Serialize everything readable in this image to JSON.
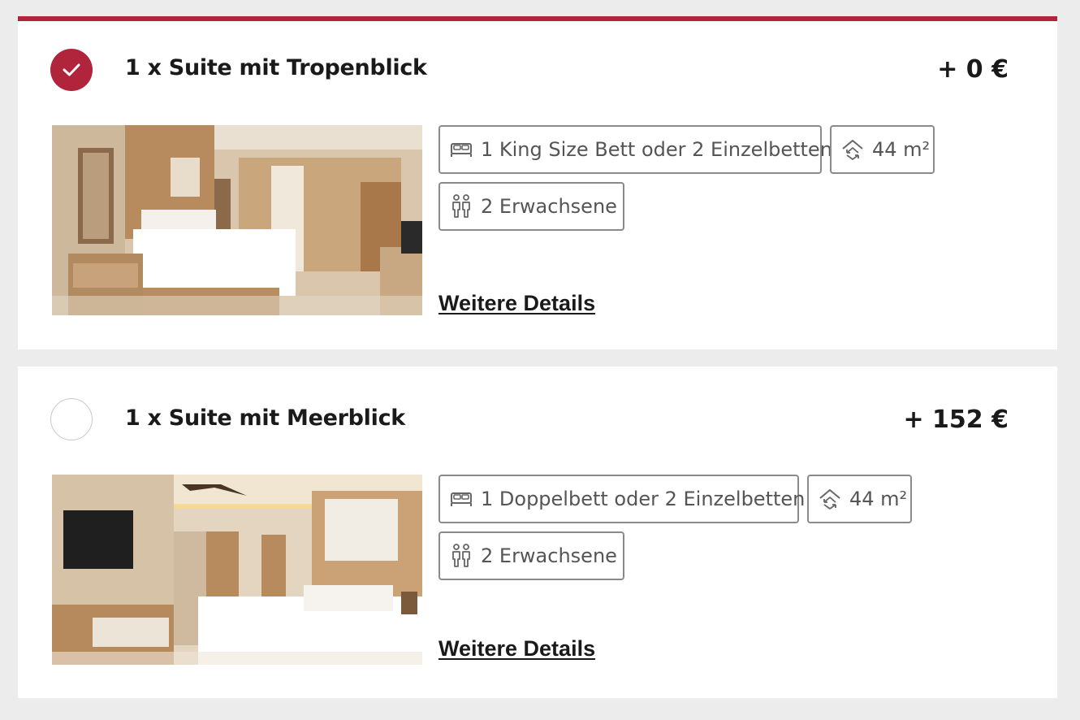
{
  "colors": {
    "accent": "#b0243c",
    "chip_border": "#8a8a8a",
    "background": "#ececec"
  },
  "rooms": [
    {
      "selected": true,
      "title": "1 x Suite mit Tropenblick",
      "price": "+ 0 €",
      "bed": "1 King Size Bett oder 2 Einzelbetten",
      "size": "44 m²",
      "guests": "2 Erwachsene",
      "details_link": "Weitere Details",
      "icons": [
        "check-icon",
        "bed-icon",
        "area-icon",
        "guests-icon"
      ]
    },
    {
      "selected": false,
      "title": "1 x Suite mit Meerblick",
      "price": "+ 152 €",
      "bed": "1 Doppelbett oder 2 Einzelbetten",
      "size": "44 m²",
      "guests": "2 Erwachsene",
      "details_link": "Weitere Details",
      "icons": [
        "bed-icon",
        "area-icon",
        "guests-icon"
      ]
    }
  ]
}
